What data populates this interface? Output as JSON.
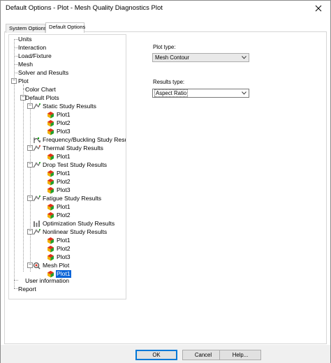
{
  "window": {
    "title": "Default Options - Plot - Mesh Quality Diagnostics Plot"
  },
  "tabs": [
    {
      "label": "System Options",
      "active": false
    },
    {
      "label": "Default Options",
      "active": true
    }
  ],
  "tree": {
    "units": "Units",
    "interaction": "Interaction",
    "load_fixture": "Load/Fixture",
    "mesh": "Mesh",
    "solver_results": "Solver and Results",
    "plot": "Plot",
    "color_chart": "Color Chart",
    "default_plots": "Default Plots",
    "static": {
      "label": "Static Study Results",
      "plots": [
        "Plot1",
        "Plot2",
        "Plot3"
      ]
    },
    "frequency": {
      "label": "Frequency/Buckling Study Results"
    },
    "thermal": {
      "label": "Thermal Study Results",
      "plots": [
        "Plot1"
      ]
    },
    "drop_test": {
      "label": "Drop Test Study Results",
      "plots": [
        "Plot1",
        "Plot2",
        "Plot3"
      ]
    },
    "fatigue": {
      "label": "Fatigue Study Results",
      "plots": [
        "Plot1",
        "Plot2"
      ]
    },
    "optimization": {
      "label": "Optimization Study Results"
    },
    "nonlinear": {
      "label": "Nonlinear Study Results",
      "plots": [
        "Plot1",
        "Plot2",
        "Plot3"
      ]
    },
    "mesh_plot": {
      "label": "Mesh Plot",
      "plots": [
        "Plot1"
      ]
    },
    "user_information": "User information",
    "report": "Report"
  },
  "form": {
    "plot_type": {
      "label": "Plot type:",
      "value": "Mesh Contour"
    },
    "results_type": {
      "label": "Results type:",
      "value": "Aspect Ratio"
    }
  },
  "buttons": {
    "ok": "OK",
    "cancel": "Cancel",
    "help": "Help..."
  },
  "colors": {
    "accent": "#0078d7",
    "selection": "#0a64d8"
  }
}
